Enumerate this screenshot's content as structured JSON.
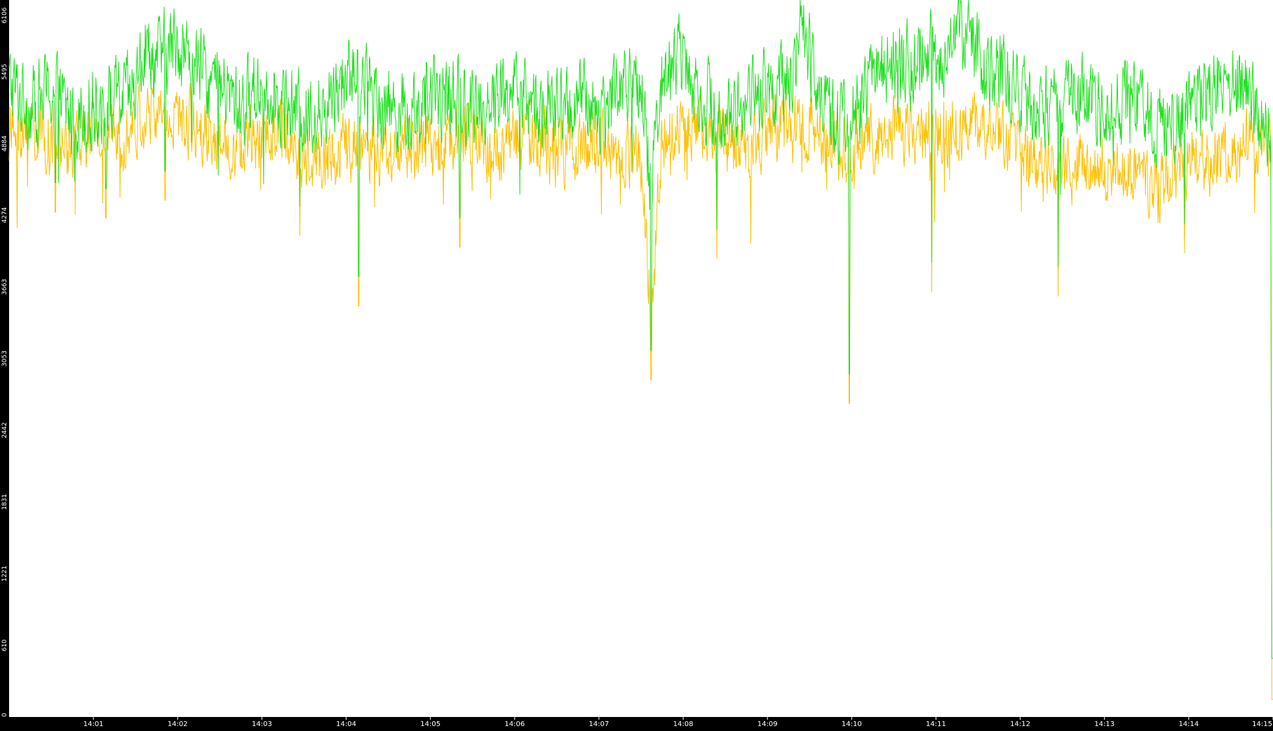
{
  "chart_data": {
    "type": "line",
    "title": "",
    "xlabel": "",
    "ylabel": "",
    "ylim": [
      0,
      6106
    ],
    "y_ticks": [
      "0",
      "610",
      "1221",
      "1831",
      "2442",
      "3053",
      "3663",
      "4274",
      "4884",
      "5495",
      "6106"
    ],
    "x_ticks": [
      "14:01",
      "14:02",
      "14:03",
      "14:04",
      "14:05",
      "14:06",
      "14:07",
      "14:08",
      "14:09",
      "14:10",
      "14:11",
      "14:12",
      "14:13",
      "14:14",
      "14:15"
    ],
    "x_range_minutes": [
      0.0,
      15.0
    ],
    "grid": false,
    "legend": "none",
    "colors": {
      "background": "#000000",
      "plot": "#ffffff",
      "series_a": "#22e022",
      "series_b": "#ffc000",
      "axis_text": "#ffffff"
    },
    "series": [
      {
        "color": "#22e022",
        "x": [
          0.0,
          0.25,
          0.5,
          0.75,
          1.0,
          1.25,
          1.5,
          1.6,
          1.75,
          2.0,
          2.25,
          2.5,
          2.75,
          3.0,
          3.25,
          3.5,
          3.75,
          4.0,
          4.25,
          4.5,
          4.75,
          5.0,
          5.25,
          5.5,
          5.75,
          6.0,
          6.25,
          6.5,
          6.75,
          7.0,
          7.25,
          7.5,
          7.62,
          7.75,
          8.0,
          8.25,
          8.5,
          8.75,
          9.0,
          9.25,
          9.4,
          9.6,
          9.75,
          9.95,
          10.1,
          10.25,
          10.5,
          10.75,
          10.9,
          11.0,
          11.25,
          11.5,
          11.75,
          12.0,
          12.25,
          12.5,
          12.75,
          13.0,
          13.25,
          13.5,
          13.75,
          14.0,
          14.25,
          14.5,
          14.75,
          15.0
        ],
        "y": [
          5400,
          5200,
          5350,
          5100,
          5200,
          5250,
          5300,
          5700,
          5600,
          5750,
          5500,
          5350,
          5200,
          5400,
          5250,
          5100,
          5200,
          5500,
          5400,
          5200,
          5150,
          5250,
          5300,
          5200,
          5250,
          5350,
          5200,
          5150,
          5250,
          5150,
          5400,
          5300,
          4500,
          5500,
          5650,
          5250,
          5100,
          5250,
          5400,
          5350,
          5850,
          5450,
          5100,
          5050,
          5200,
          5500,
          5600,
          5550,
          5700,
          5600,
          5800,
          5650,
          5500,
          5300,
          5200,
          5200,
          5300,
          5200,
          5250,
          5100,
          5050,
          5200,
          5350,
          5400,
          5250,
          4900
        ]
      },
      {
        "color": "#ffc000",
        "x": [
          0.0,
          0.25,
          0.5,
          0.75,
          1.0,
          1.25,
          1.5,
          1.75,
          2.0,
          2.25,
          2.5,
          2.75,
          3.0,
          3.25,
          3.5,
          3.75,
          4.0,
          4.25,
          4.5,
          4.75,
          5.0,
          5.25,
          5.5,
          5.75,
          6.0,
          6.25,
          6.5,
          6.75,
          7.0,
          7.25,
          7.5,
          7.62,
          7.75,
          8.0,
          8.25,
          8.5,
          8.75,
          9.0,
          9.25,
          9.5,
          9.75,
          9.95,
          10.1,
          10.25,
          10.5,
          10.75,
          11.0,
          11.25,
          11.5,
          11.75,
          12.0,
          12.25,
          12.5,
          12.75,
          13.0,
          13.25,
          13.5,
          13.75,
          14.0,
          14.25,
          14.5,
          14.75,
          15.0
        ],
        "y": [
          4950,
          5000,
          4900,
          4850,
          4950,
          4950,
          5050,
          5150,
          5100,
          5050,
          4900,
          4850,
          4950,
          5000,
          4750,
          4800,
          4850,
          4800,
          4800,
          4850,
          4850,
          4900,
          4950,
          4850,
          4900,
          4950,
          4800,
          4850,
          4900,
          4800,
          4750,
          3400,
          4950,
          5000,
          5000,
          4900,
          4850,
          4950,
          5000,
          5050,
          4900,
          4850,
          4950,
          4900,
          5000,
          4950,
          5050,
          5000,
          5050,
          4950,
          4800,
          4650,
          4600,
          4750,
          4700,
          4650,
          4550,
          4500,
          4700,
          4750,
          4850,
          4900,
          4850
        ]
      }
    ],
    "notable_dips": [
      {
        "x": 0.55,
        "y": 4300
      },
      {
        "x": 1.15,
        "y": 4250
      },
      {
        "x": 1.85,
        "y": 4400
      },
      {
        "x": 3.45,
        "y": 4100
      },
      {
        "x": 4.15,
        "y": 3500
      },
      {
        "x": 5.35,
        "y": 4000
      },
      {
        "x": 7.62,
        "y": 2870
      },
      {
        "x": 8.4,
        "y": 3900
      },
      {
        "x": 9.97,
        "y": 2670
      },
      {
        "x": 10.95,
        "y": 3620
      },
      {
        "x": 12.45,
        "y": 3580
      },
      {
        "x": 13.95,
        "y": 3950
      },
      {
        "x": 14.98,
        "y": 2500
      },
      {
        "x": 14.99,
        "y": 250
      }
    ]
  }
}
